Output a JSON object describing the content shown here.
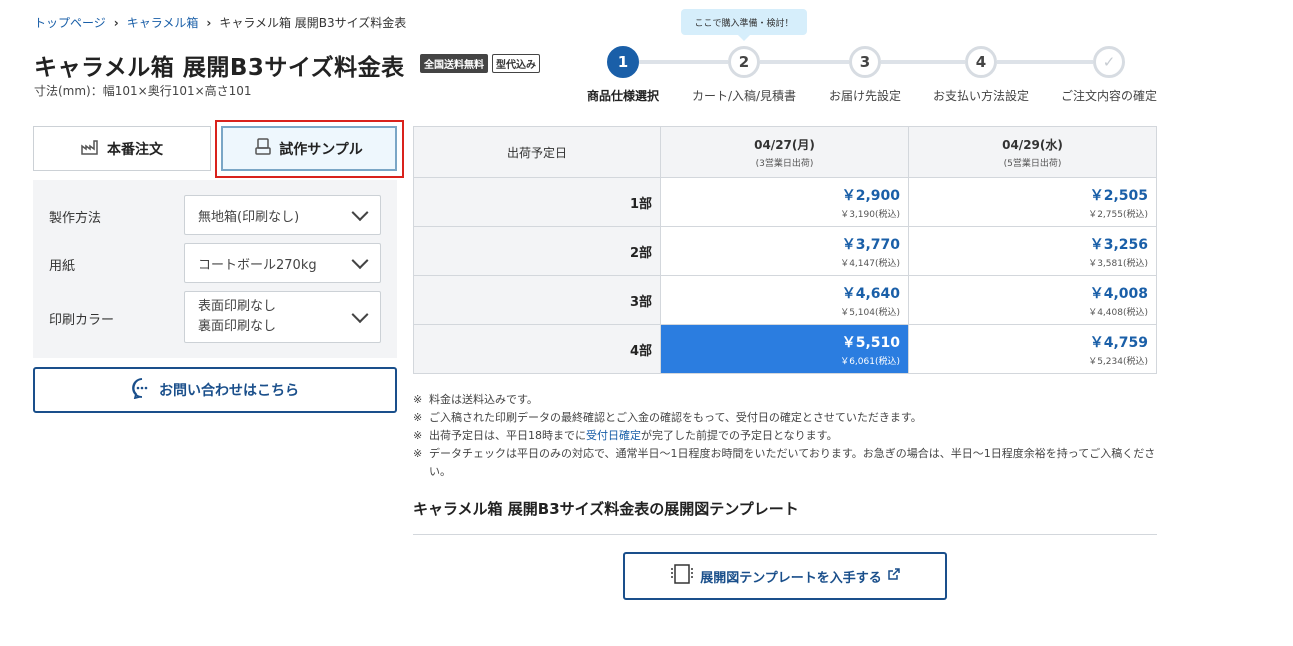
{
  "breadcrumb": {
    "items": [
      "トップページ",
      "キャラメル箱"
    ],
    "current": "キャラメル箱 展開B3サイズ料金表"
  },
  "product": {
    "title": "キャラメル箱 展開B3サイズ料金表",
    "badges": [
      "全国送料無料",
      "型代込み"
    ],
    "dimensions": "寸法(mm)：幅101×奥行101×高さ101"
  },
  "steps": {
    "tooltip": "ここで購入準備・検討！",
    "items": [
      {
        "num": "1",
        "label": "商品仕様選択",
        "state": "active"
      },
      {
        "num": "2",
        "label": "カート/入稿/見積書",
        "state": "todo"
      },
      {
        "num": "3",
        "label": "お届け先設定",
        "state": "todo"
      },
      {
        "num": "4",
        "label": "お支払い方法設定",
        "state": "todo"
      },
      {
        "num": "✓",
        "label": "ご注文内容の確定",
        "state": "done"
      }
    ]
  },
  "order_tabs": {
    "main_label": "本番注文",
    "sample_label": "試作サンプル"
  },
  "spec": {
    "method_label": "製作方法",
    "method_value": "無地箱(印刷なし)",
    "paper_label": "用紙",
    "paper_value": "コートボール270kg",
    "color_label": "印刷カラー",
    "color_value_line1": "表面印刷なし",
    "color_value_line2": "裏面印刷なし"
  },
  "contact_label": "お問い合わせはこちら",
  "price_table": {
    "header_label": "出荷予定日",
    "columns": [
      {
        "date": "04/27(月)",
        "sub": "(3営業日出荷)"
      },
      {
        "date": "04/29(水)",
        "sub": "(5営業日出荷)"
      }
    ],
    "rows": [
      {
        "qty": "1部",
        "prices": [
          {
            "main": "￥2,900",
            "tax": "￥3,190(税込)"
          },
          {
            "main": "￥2,505",
            "tax": "￥2,755(税込)"
          }
        ]
      },
      {
        "qty": "2部",
        "prices": [
          {
            "main": "￥3,770",
            "tax": "￥4,147(税込)"
          },
          {
            "main": "￥3,256",
            "tax": "￥3,581(税込)"
          }
        ]
      },
      {
        "qty": "3部",
        "prices": [
          {
            "main": "￥4,640",
            "tax": "￥5,104(税込)"
          },
          {
            "main": "￥4,008",
            "tax": "￥4,408(税込)"
          }
        ]
      },
      {
        "qty": "4部",
        "prices": [
          {
            "main": "￥5,510",
            "tax": "￥6,061(税込)"
          },
          {
            "main": "￥4,759",
            "tax": "￥5,234(税込)"
          }
        ]
      }
    ],
    "selected": {
      "row": 3,
      "col": 0
    }
  },
  "notes": {
    "mark": "※",
    "n1": "料金は送料込みです。",
    "n2": "ご入稿された印刷データの最終確認とご入金の確認をもって、受付日の確定とさせていただきます。",
    "n3_pre": "出荷予定日は、平日18時までに",
    "n3_link": "受付日確定",
    "n3_post": "が完了した前提での予定日となります。",
    "n4": "データチェックは平日のみの対応で、通常半日〜1日程度お時間をいただいております。お急ぎの場合は、半日〜1日程度余裕を持ってご入稿ください。"
  },
  "template": {
    "heading": "キャラメル箱 展開B3サイズ料金表の展開図テンプレート",
    "button_label": "展開図テンプレートを入手する"
  },
  "colors": {
    "accent": "#1a5fa8",
    "selected_cell": "#2b7de0",
    "highlight": "#d9221c"
  }
}
